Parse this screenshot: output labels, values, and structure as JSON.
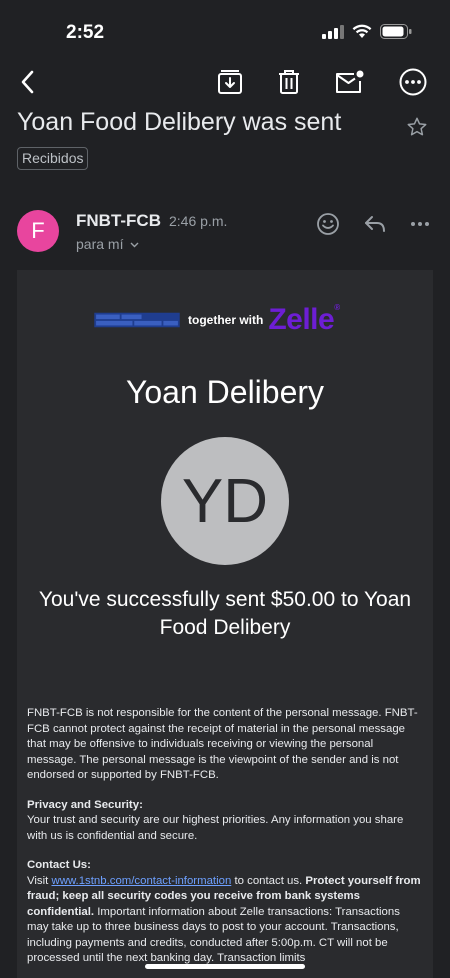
{
  "status_bar": {
    "time": "2:52"
  },
  "email": {
    "subject": "Yoan Food Delibery was sent",
    "label": "Recibidos",
    "sender_initial": "F",
    "sender": "FNBT-FCB",
    "time": "2:46 p.m.",
    "recipient": "para mí"
  },
  "body": {
    "together_with": "together with",
    "zelle_brand": "Zelle",
    "recipient_name": "Yoan Delibery",
    "initials": "YD",
    "success_message": "You've successfully sent $50.00 to Yoan Food Delibery",
    "disclaimer": "FNBT-FCB is not responsible for the content of the personal message. FNBT-FCB cannot protect against the receipt of material in the personal message that may be offensive to individuals receiving or viewing the personal message. The personal message is the viewpoint of the sender and is not endorsed or supported by FNBT-FCB.",
    "privacy_heading": "Privacy and Security:",
    "privacy_text": "Your trust and security are our highest priorities. Any information you share with us is confidential and secure.",
    "contact_heading": "Contact Us:",
    "contact_visit": "Visit",
    "contact_link": "www.1stnb.com/contact-information",
    "contact_to_us": "to contact us.",
    "contact_bold": "Protect yourself from fraud; keep all security codes you receive from bank systems confidential.",
    "contact_rest": "Important information about Zelle transactions: Transactions may take up to three business days to post to your account. Transactions, including payments and credits, conducted after 5:00p.m. CT will not be processed until the next banking day. Transaction limits"
  },
  "colors": {
    "background": "#202124",
    "card": "#2a2b2e",
    "avatar": "#e8459e",
    "zelle_purple": "#6d1ed4",
    "link": "#6ea0ff"
  }
}
